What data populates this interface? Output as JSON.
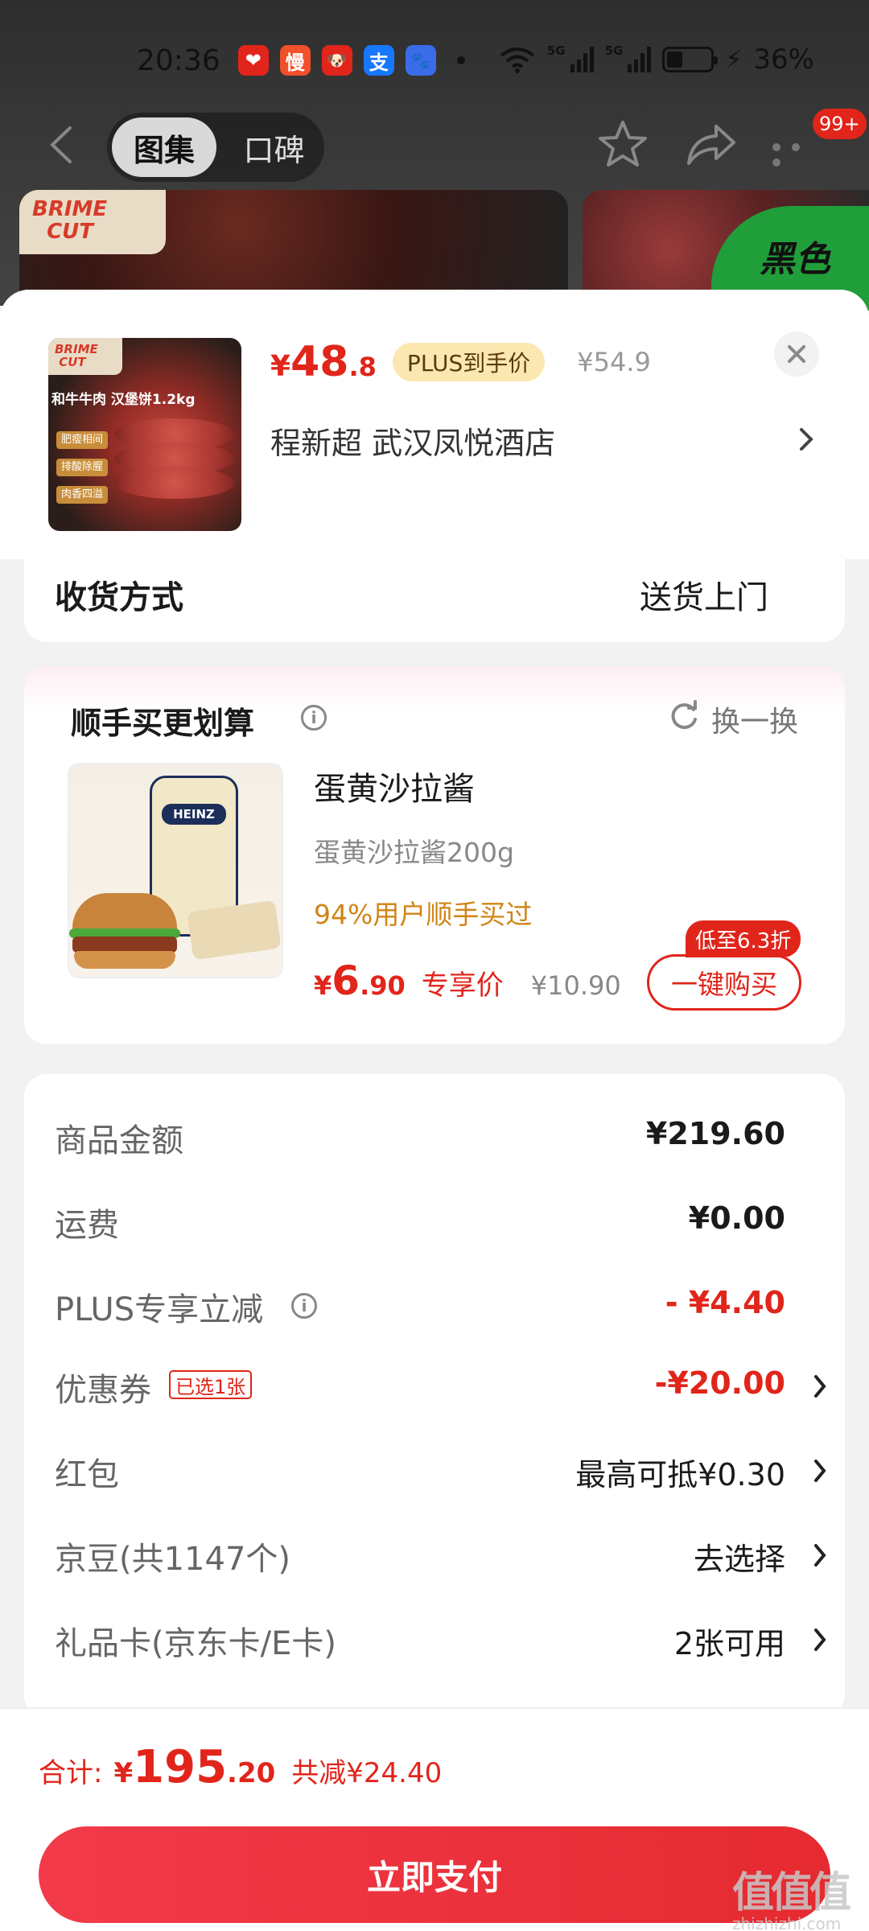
{
  "status_bar": {
    "time": "20:36",
    "apps": [
      {
        "icon": "app-icon-red-heart",
        "color": "#e1251b",
        "glyph": "❤"
      },
      {
        "icon": "app-icon-man",
        "color": "#f0502a",
        "glyph": "慢"
      },
      {
        "icon": "app-icon-dog",
        "color": "#e1251b",
        "glyph": "🐶"
      },
      {
        "icon": "app-icon-alipay",
        "color": "#1677ff",
        "glyph": "支"
      },
      {
        "icon": "app-icon-baidu",
        "color": "#3a6be8",
        "glyph": "🐾"
      }
    ],
    "net1": "5G",
    "net2": "5G",
    "battery": "36%",
    "battery_level": 0.36
  },
  "nav": {
    "tab_active": "图集",
    "tab_inactive": "口碑",
    "badge": "99+"
  },
  "gallery": {
    "brand": "BRIME CUT",
    "badge_text": "黑色"
  },
  "product": {
    "image_brand": "BRIME CUT",
    "image_title": "和牛牛肉 汉堡饼1.2kg",
    "image_chips": [
      "肥瘦相间",
      "排酸除腥",
      "肉香四溢"
    ],
    "price_symbol": "¥",
    "price_int": "48",
    "price_dec": ".8",
    "plus_tag": "PLUS到手价",
    "original_price": "¥54.9",
    "address": "程新超  武汉凤悦酒店"
  },
  "delivery": {
    "label": "收货方式",
    "value": "送货上门"
  },
  "addon": {
    "title": "顺手买更划算",
    "refresh_label": "换一换",
    "image_brand": "HEINZ",
    "name": "蛋黄沙拉酱",
    "spec": "蛋黄沙拉酱200g",
    "popularity": "94%用户顺手买过",
    "price_symbol": "¥",
    "price_int": "6",
    "price_dec": ".90",
    "price_tag": "专享价",
    "original_price": "¥10.90",
    "discount_tag": "低至6.3折",
    "buy_label": "一键购买"
  },
  "summary": {
    "goods_amount": {
      "label": "商品金额",
      "value": "¥219.60"
    },
    "shipping": {
      "label": "运费",
      "value": "¥0.00"
    },
    "plus_discount": {
      "label": "PLUS专享立减",
      "value": "- ¥4.40"
    },
    "coupon": {
      "label": "优惠券",
      "tag": "已选1张",
      "value": "-¥20.00"
    },
    "red_packet": {
      "label": "红包",
      "value": "最高可抵¥0.30"
    },
    "jingdou": {
      "label": "京豆(共1147个)",
      "value": "去选择"
    },
    "gift_card": {
      "label": "礼品卡(京东卡/E卡)",
      "value": "2张可用"
    }
  },
  "footer": {
    "total_label": "合计:",
    "total_symbol": "¥",
    "total_int": "195",
    "total_dec": ".20",
    "total_saved": "共减¥24.40",
    "pay_label": "立即支付"
  },
  "watermark": {
    "logo": "值值值",
    "domain": "zhizhizhi.com"
  },
  "colors": {
    "accent": "#e1251b",
    "plus_tag_bg": "#fbe7b0",
    "popularity": "#d08416"
  }
}
